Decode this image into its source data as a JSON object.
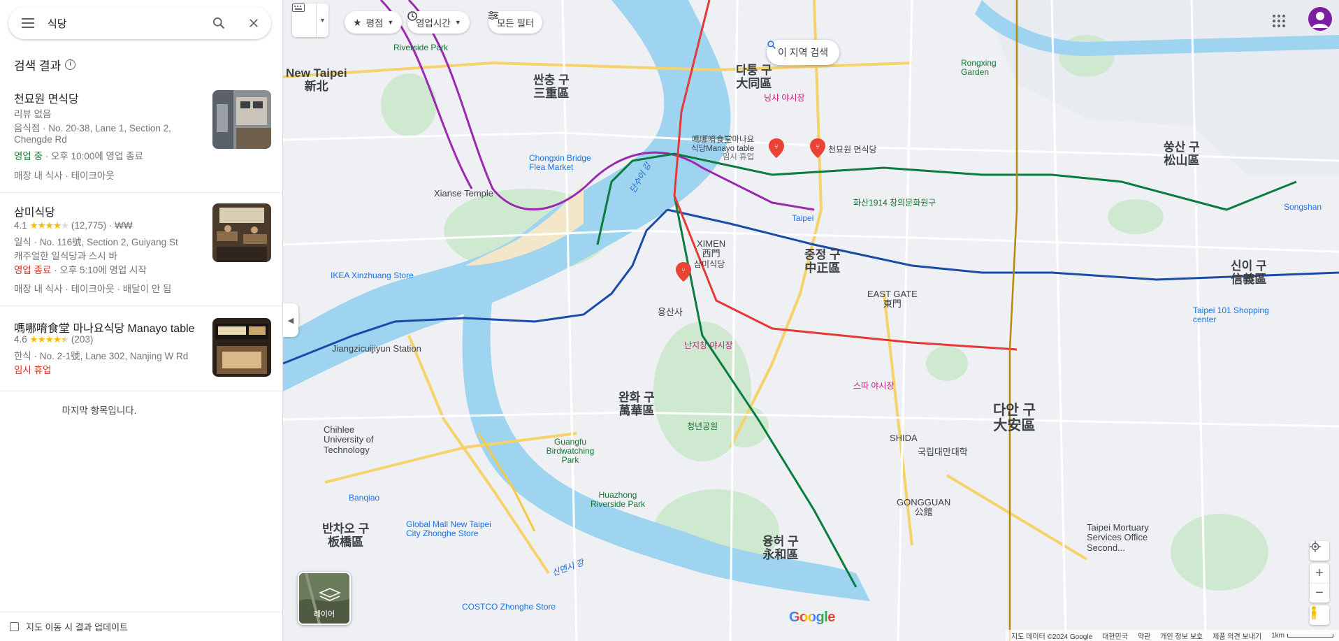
{
  "search": {
    "query": "식당"
  },
  "results": {
    "heading": "검색 결과",
    "items": [
      {
        "name": "천묘원 면식당",
        "line1": "리뷰 없음",
        "line2": "음식점 · No. 20-38, Lane 1, Section 2,",
        "line3": "Chengde Rd",
        "status": "영업 중",
        "status_detail": " · 오후 10:00에 영업 종료",
        "options": "매장 내 식사 · 테이크아웃"
      },
      {
        "name": "삼미식당",
        "rating": "4.1",
        "stars": 4,
        "reviews": "(12,775)",
        "price": " · ₩₩",
        "line2": "일식 · No. 116號, Section 2, Guiyang St",
        "line3": "캐주얼한 일식당과 스시 바",
        "status": "영업 종료",
        "status_detail": " · 오후 5:10에 영업 시작",
        "options": "매장 내 식사 · 테이크아웃 · 배달이 안 됨"
      },
      {
        "name": "嗎哪唷食堂 마나요식당 Manayo table",
        "rating": "4.6",
        "stars": 4.5,
        "reviews": "(203)",
        "line2": "한식 · No. 2-1號, Lane 302, Nanjing W Rd",
        "status": "임시 휴업"
      }
    ],
    "end_text": "마지막 항목입니다.",
    "update_on_move": "지도 이동 시 결과 업데이트"
  },
  "filters": {
    "rating": "평점",
    "hours": "영업시간",
    "all": "모든 필터"
  },
  "map": {
    "area_search": "이 지역 검색",
    "layers": "레이어",
    "logo": "Google",
    "attribution": {
      "data": "지도 데이터 ©2024 Google",
      "taiwan": "대한민국",
      "terms": "약관",
      "privacy": "개인 정보 보호",
      "feedback": "제품 의견 보내기",
      "scale": "1km"
    },
    "labels": {
      "new_taipei": "New Taipei",
      "new_taipei_cn": "新北",
      "sanchong": "싼충 구",
      "sanchong_cn": "三重區",
      "datong": "다퉁 구",
      "datong_cn": "大同區",
      "songshan": "쑹산 구",
      "songshan_cn": "松山區",
      "zhongzheng": "중정 구",
      "zhongzheng_cn": "中正區",
      "wanhua": "완화 구",
      "wanhua_cn": "萬華區",
      "daan": "다안 구",
      "daan_cn": "大安區",
      "xinyi": "신이 구",
      "xinyi_cn": "信義區",
      "banqiao": "반차오 구",
      "banqiao_cn": "板橋區",
      "yonghe": "융허 구",
      "yonghe_cn": "永和區",
      "ximen": "XIMEN",
      "ximen_cn": "西門",
      "east_gate": "EAST GATE",
      "east_gate_cn": "東門",
      "shida": "SHIDA",
      "gongguan": "GONGGUAN",
      "gongguan_cn": "公館",
      "rongxing": "Rongxing Garden",
      "riverside": "Riverside Park",
      "chongxin": "Chongxin Bridge Flea Market",
      "xianse": "Xianse Temple",
      "ikea": "IKEA Xinzhuang Store",
      "jiangzi": "Jiangzicuijiyun Station",
      "chihlee": "Chihlee University of Technology",
      "banqiao_st": "Banqiao",
      "global_mall": "Global Mall New Taipei City Zhonghe Store",
      "costco": "COSTCO Zhonghe Store",
      "huazhong": "Huazhong Riverside Park",
      "guangfu": "Guangfu Birdwatching Park",
      "taipei101": "Taipei 101 Shopping center",
      "mortuary": "Taipei Mortuary Services Office Second...",
      "songshan_st": "Songshan",
      "tamsui": "단수이 강",
      "xindian": "신뎬시 강",
      "ningxia": "닝샤 야시장",
      "huashan": "화산1914 창의문화원구",
      "longshan": "용산사",
      "nanjichang": "난지창 야시장",
      "shida_market": "스따 야시장",
      "ntu": "국립대만대학",
      "youth_park": "청년공원",
      "mrt_taipei": "Taipei",
      "tianmiao": "천묘원 면식당",
      "sanmi": "삼미식당",
      "manayo1": "嗎哪唷食堂마나요",
      "manayo2": "식당Manayo table",
      "manayo3": "임시 휴업"
    }
  }
}
